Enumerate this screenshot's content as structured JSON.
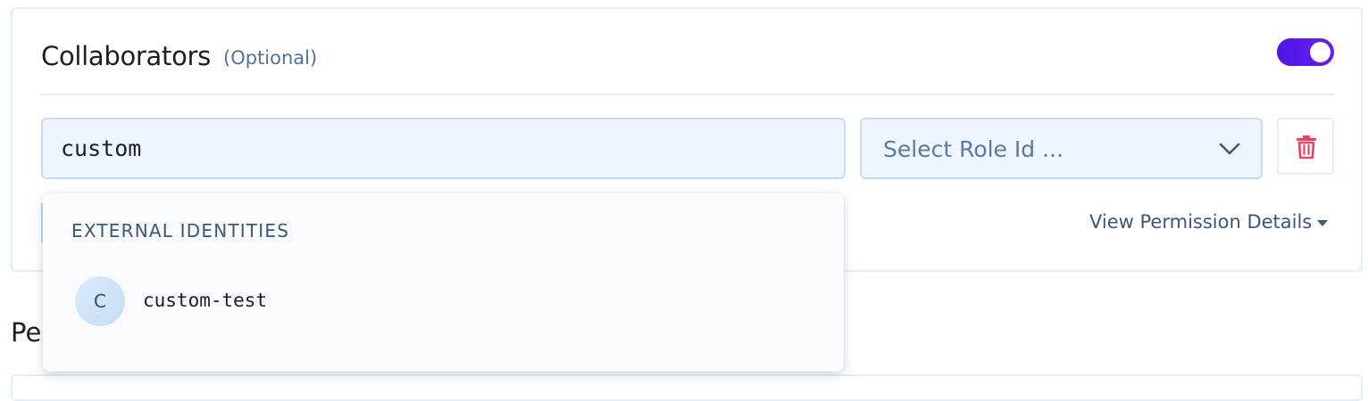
{
  "section": {
    "title": "Collaborators",
    "optional_label": "(Optional)",
    "toggle_on": true,
    "accent_color": "#5a1bea"
  },
  "collaborator_row": {
    "search_value": "custom",
    "role_select": {
      "placeholder": "Select Role Id ..."
    }
  },
  "view_permission_details_label": "View Permission Details",
  "dropdown": {
    "group_label": "EXTERNAL IDENTITIES",
    "options": [
      {
        "avatar_initial": "C",
        "label": "custom-test"
      }
    ]
  },
  "next_section_title_partial": "Pe",
  "icons": {
    "delete": "trash-icon",
    "select_chevron": "chevron-down-icon",
    "details_caret": "caret-down-icon"
  },
  "colors": {
    "delete_icon": "#e8455f",
    "input_background": "#eef5fd",
    "input_border": "#c6dcf3"
  }
}
